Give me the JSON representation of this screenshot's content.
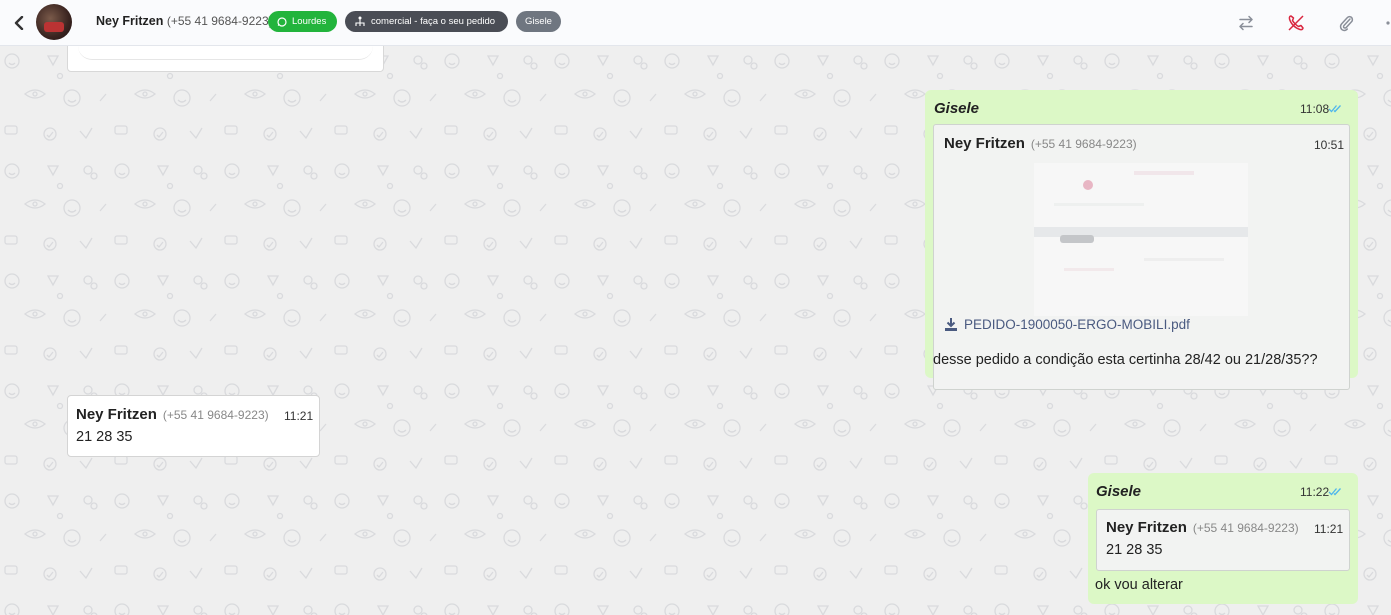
{
  "header": {
    "contact_name": "Ney Fritzen",
    "contact_phone": "(+55 41 9684-9223)",
    "tags": {
      "connection": "Lourdes",
      "queue": "comercial - faça o seu pedido",
      "agent": "Gisele"
    },
    "icons": [
      "back-icon",
      "transfer-icon",
      "call-off-icon",
      "attach-icon",
      "more-icon"
    ]
  },
  "colors": {
    "outgoing_bubble": "#dcf8c6",
    "tag_green": "#22b43c",
    "tag_dark": "#4a4d55",
    "tag_gray": "#6f7680",
    "read_ticks": "#4fb6ec",
    "call_icon": "#d9263f"
  },
  "messages": [
    {
      "direction": "out",
      "sender": "Gisele",
      "time": "11:08",
      "quote": {
        "name": "Ney Fritzen",
        "phone": "(+55 41 9684-9223)",
        "time": "10:51",
        "file": "PEDIDO-1900050-ERGO-MOBILI.pdf"
      },
      "text": "desse pedido a condição esta certinha 28/42 ou 21/28/35??"
    },
    {
      "direction": "in",
      "name": "Ney Fritzen",
      "phone": "(+55 41 9684-9223)",
      "time": "11:21",
      "text": "21 28 35"
    },
    {
      "direction": "out",
      "sender": "Gisele",
      "time": "11:22",
      "quote": {
        "name": "Ney Fritzen",
        "phone": "(+55 41 9684-9223)",
        "time": "11:21",
        "text": "21 28 35"
      },
      "text": "ok vou alterar"
    }
  ]
}
